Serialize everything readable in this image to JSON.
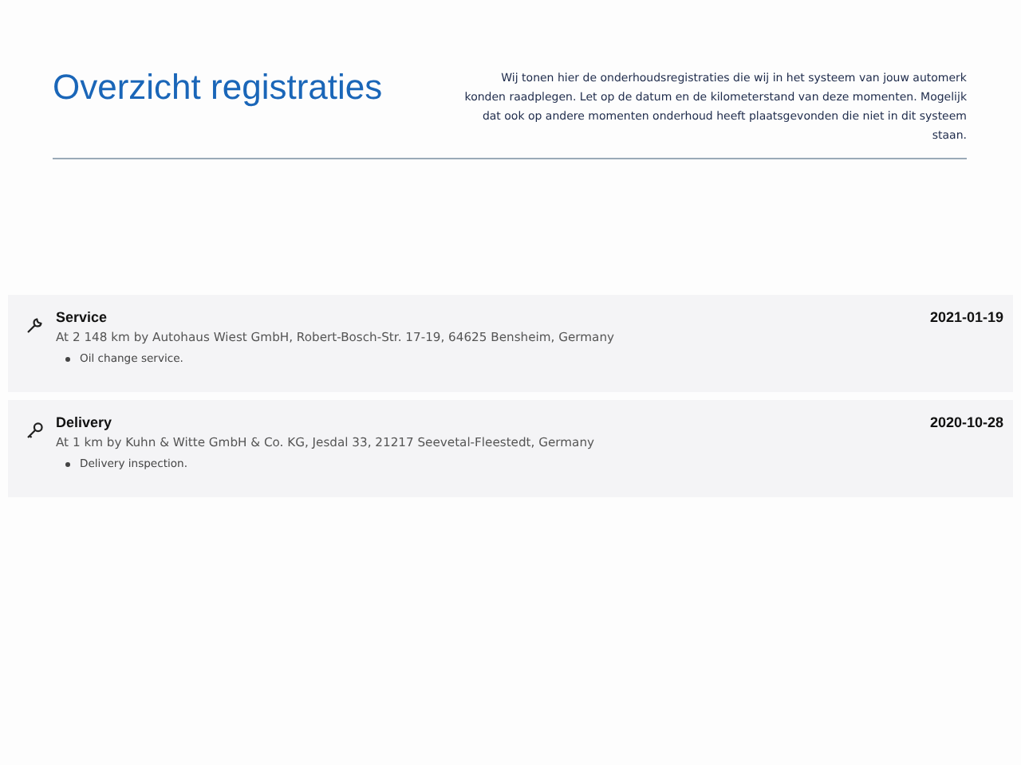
{
  "header": {
    "title": "Overzicht registraties",
    "description": "Wij tonen hier de onderhoudsregistraties die wij in het systeem van jouw automerk konden raadplegen. Let op de datum en de kilometerstand van deze momenten. Mogelijk dat ook op andere momenten onderhoud heeft plaatsgevonden die niet in dit systeem staan."
  },
  "registrations": [
    {
      "kind": "service",
      "title": "Service",
      "date": "2021-01-19",
      "details": "At 2 148 km by Autohaus Wiest GmbH, Robert-Bosch-Str. 17-19, 64625 Bensheim, Germany",
      "items": [
        "Oil change service."
      ]
    },
    {
      "kind": "delivery",
      "title": "Delivery",
      "date": "2020-10-28",
      "details": "At 1 km by Kuhn & Witte GmbH & Co. KG, Jesdal 33, 21217 Seevetal-Fleestedt, Germany",
      "items": [
        "Delivery inspection."
      ]
    }
  ]
}
